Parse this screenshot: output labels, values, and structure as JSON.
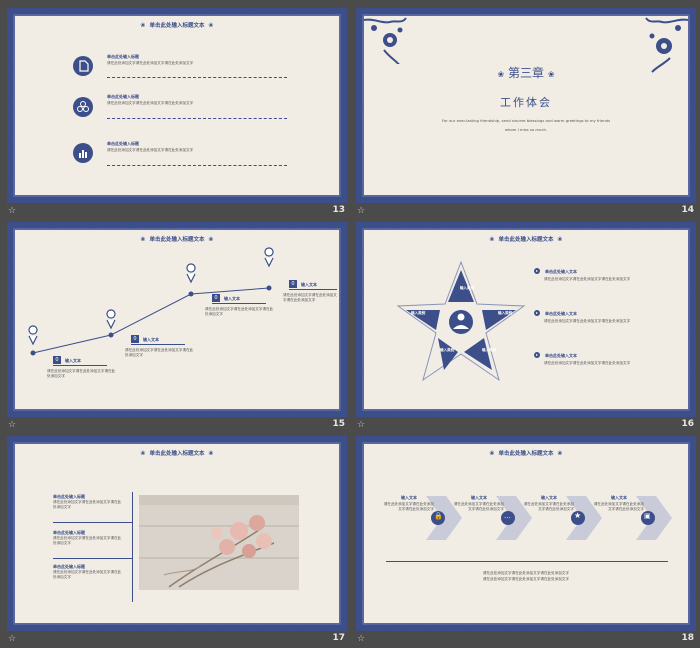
{
  "slide_title": "单击此处输入标题文本",
  "title_ornament_left": "❀",
  "title_ornament_right": "❀",
  "star_glyph": "☆",
  "slides": [
    {
      "num": "13"
    },
    {
      "num": "14"
    },
    {
      "num": "15"
    },
    {
      "num": "16"
    },
    {
      "num": "17"
    },
    {
      "num": "18"
    }
  ],
  "heading_placeholder": "单击此处输入标题",
  "body_placeholder": "请在此处添加文字请在此处添加文字请在此处添加文字",
  "input_text": "输入文本",
  "input_cat": "输入类别",
  "chapter": {
    "title": "第三章",
    "subtitle": "工作体会",
    "english_line1": "For our ever-lasting friendship, send sincere blessings and warm greetings to my friends",
    "english_line2": "whom I miss so much."
  },
  "timeline_tags": [
    "0",
    "0",
    "0",
    "0"
  ],
  "star_items": [
    "单击此处输入文本",
    "单击此处输入文本",
    "单击此处输入文本"
  ],
  "colors": {
    "accent": "#3c4f8a",
    "paper": "#f1ede5",
    "chevron": "#c9cbd9"
  },
  "icons": {
    "slide13": [
      "document-icon",
      "network-icon",
      "bar-chart-icon"
    ],
    "slide18": [
      "lock-icon",
      "chat-icon",
      "star-icon",
      "briefcase-icon"
    ]
  }
}
